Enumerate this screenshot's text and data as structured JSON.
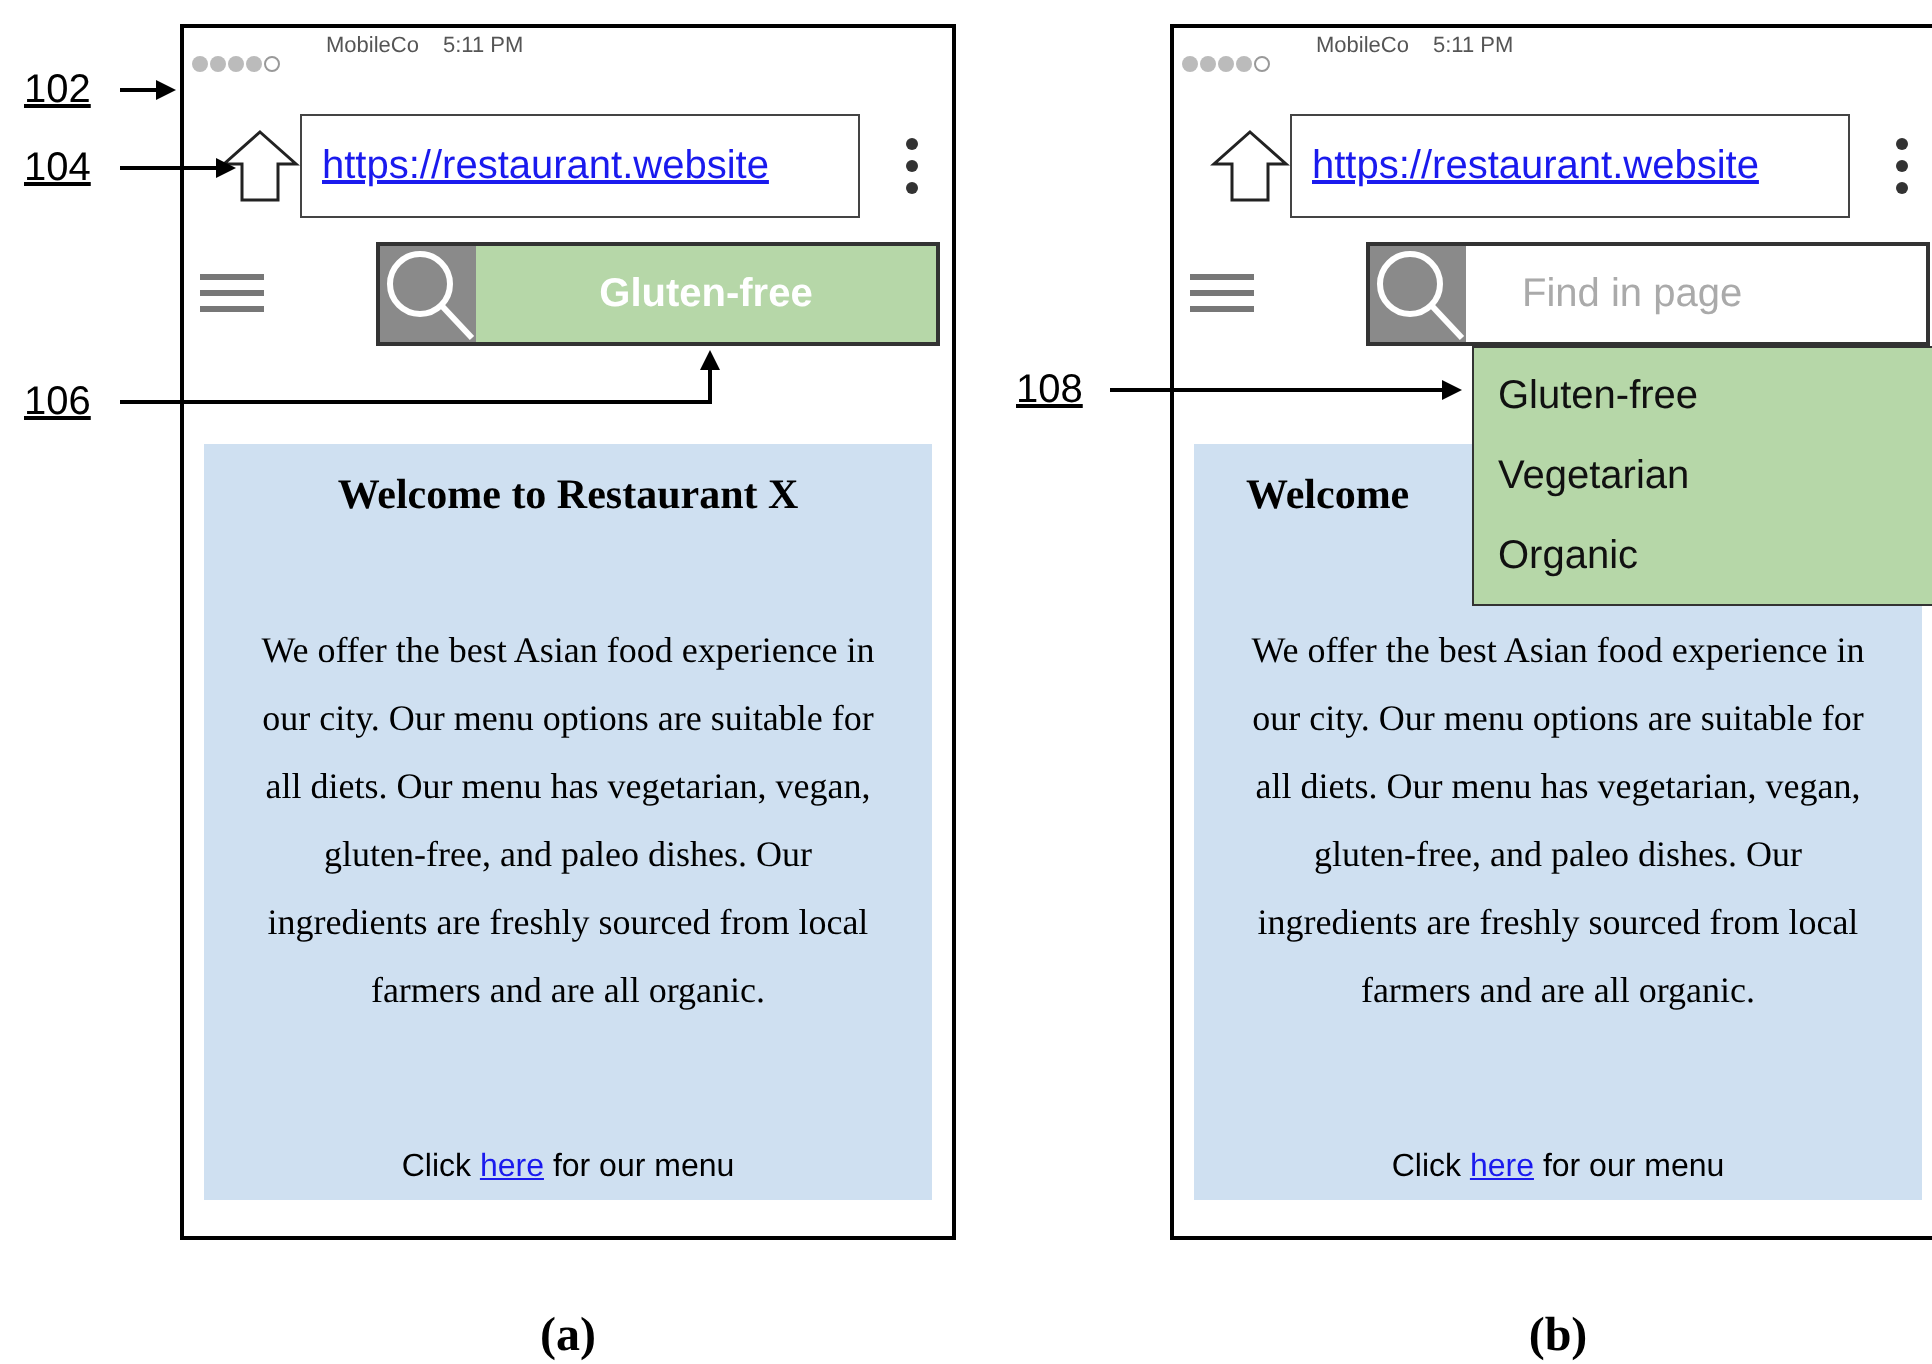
{
  "panels": [
    {
      "caption": "(a)",
      "carrier": "MobileCo",
      "time": "5:11 PM",
      "url": "https://restaurant.website",
      "search": {
        "value": "Gluten-free"
      },
      "callouts": [
        {
          "label": "102",
          "kind": "frame"
        },
        {
          "label": "104",
          "kind": "home"
        },
        {
          "label": "106",
          "kind": "search"
        }
      ],
      "content": {
        "heading": "Welcome to Restaurant X",
        "body": "We offer the best Asian food experience in our city. Our menu options are suitable for all diets. Our menu has vegetarian, vegan, gluten-free, and paleo dishes. Our ingredients are freshly sourced from local farmers and are all organic.",
        "link_before": "Click",
        "link": "here",
        "link_after": "for our menu"
      }
    },
    {
      "caption": "(b)",
      "carrier": "MobileCo",
      "time": "5:11 PM",
      "url": "https://restaurant.website",
      "search": {
        "placeholder": "Find in page",
        "expanded": true,
        "options": [
          "Gluten-free",
          "Vegetarian",
          "Organic"
        ]
      },
      "callouts": [
        {
          "label": "108",
          "kind": "dropdown"
        }
      ],
      "content": {
        "heading": "Welcome",
        "body": "We offer the best Asian food experience in our city. Our menu options are suitable for all diets. Our menu has vegetarian, vegan, gluten-free, and paleo dishes. Our ingredients are freshly sourced from local farmers and are all organic.",
        "link_before": "Click",
        "link": "here",
        "link_after": "for our menu"
      }
    }
  ]
}
